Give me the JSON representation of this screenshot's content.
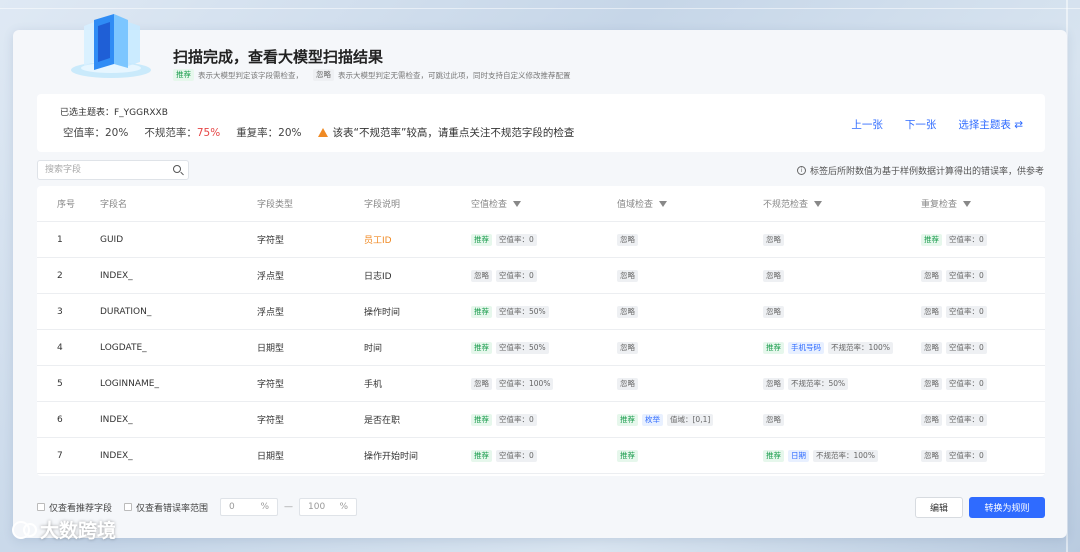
{
  "header": {
    "title": "扫描完成，查看大模型扫描结果",
    "legend_recommend_tag": "推荐",
    "legend_recommend_text": "表示大模型判定该字段需检查，",
    "legend_ignore_tag": "忽略",
    "legend_ignore_text": "表示大模型判定无需检查，可跳过此项，同时支持自定义修改推荐配置"
  },
  "info": {
    "selected_table": "已选主题表：F_YGGRXXB",
    "null_rate": "空值率：20%",
    "irregular_label": "不规范率：",
    "irregular_value": "75%",
    "dup_rate": "重复率：20%",
    "warning": "该表“不规范率”较高，请重点关注不规范字段的检查",
    "prev": "上一张",
    "next": "下一张",
    "choose": "选择主题表 ⇄"
  },
  "search": {
    "placeholder": "搜索字段"
  },
  "note": "标签后所附数值为基于样例数据计算得出的错误率，供参考",
  "table": {
    "headers": [
      "序号",
      "字段名",
      "字段类型",
      "字段说明",
      "空值检查",
      "值域检查",
      "不规范检查",
      "重复检查"
    ],
    "rows": [
      {
        "idx": "1",
        "name": "GUID",
        "type": "字符型",
        "desc": "员工ID",
        "null": {
          "tag": "推荐",
          "val": "空值率：0"
        },
        "range": {
          "tag": "忽略"
        },
        "irr": {
          "tag": "忽略"
        },
        "dup": {
          "tag": "推荐",
          "val": "空值率：0"
        }
      },
      {
        "idx": "2",
        "name": "INDEX_",
        "type": "浮点型",
        "desc": "日志ID",
        "null": {
          "tag": "忽略",
          "val": "空值率：0"
        },
        "range": {
          "tag": "忽略"
        },
        "irr": {
          "tag": "忽略"
        },
        "dup": {
          "tag": "忽略",
          "val": "空值率：0"
        }
      },
      {
        "idx": "3",
        "name": "DURATION_",
        "type": "浮点型",
        "desc": "操作时间",
        "null": {
          "tag": "推荐",
          "val": "空值率：50%"
        },
        "range": {
          "tag": "忽略"
        },
        "irr": {
          "tag": "忽略"
        },
        "dup": {
          "tag": "忽略",
          "val": "空值率：0"
        }
      },
      {
        "idx": "4",
        "name": "LOGDATE_",
        "type": "日期型",
        "desc": "时间",
        "null": {
          "tag": "推荐",
          "val": "空值率：50%"
        },
        "range": {
          "tag": "忽略"
        },
        "irr": {
          "tag": "推荐",
          "extra": "手机号码",
          "val": "不规范率：100%"
        },
        "dup": {
          "tag": "忽略",
          "val": "空值率：0"
        }
      },
      {
        "idx": "5",
        "name": "LOGINNAME_",
        "type": "字符型",
        "desc": "手机",
        "null": {
          "tag": "忽略",
          "val": "空值率：100%"
        },
        "range": {
          "tag": "忽略"
        },
        "irr": {
          "tag": "忽略",
          "val": "不规范率：50%"
        },
        "dup": {
          "tag": "忽略",
          "val": "空值率：0"
        }
      },
      {
        "idx": "6",
        "name": "INDEX_",
        "type": "字符型",
        "desc": "是否在职",
        "null": {
          "tag": "推荐",
          "val": "空值率：0"
        },
        "range": {
          "tag": "推荐",
          "extra": "枚举",
          "val": "值域：[0,1]"
        },
        "irr": {
          "tag": "忽略"
        },
        "dup": {
          "tag": "忽略",
          "val": "空值率：0"
        }
      },
      {
        "idx": "7",
        "name": "INDEX_",
        "type": "日期型",
        "desc": "操作开始时间",
        "null": {
          "tag": "推荐",
          "val": "空值率：0"
        },
        "range": {
          "tag": "推荐"
        },
        "irr": {
          "tag": "推荐",
          "extra": "日期",
          "val": "不规范率：100%"
        },
        "dup": {
          "tag": "忽略",
          "val": "空值率：0"
        }
      }
    ]
  },
  "footer": {
    "only_recommended": "仅查看推荐字段",
    "only_error_range": "仅查看错误率范围",
    "range_min": "0",
    "range_max": "100",
    "percent": "%",
    "dash": "—",
    "edit": "编辑",
    "convert": "转换为规则"
  },
  "watermark": "大数跨境",
  "colors": {
    "accent": "#2f6bff",
    "warning": "#f08a24",
    "danger": "#e64545",
    "recommend": "#1a9c4d"
  }
}
